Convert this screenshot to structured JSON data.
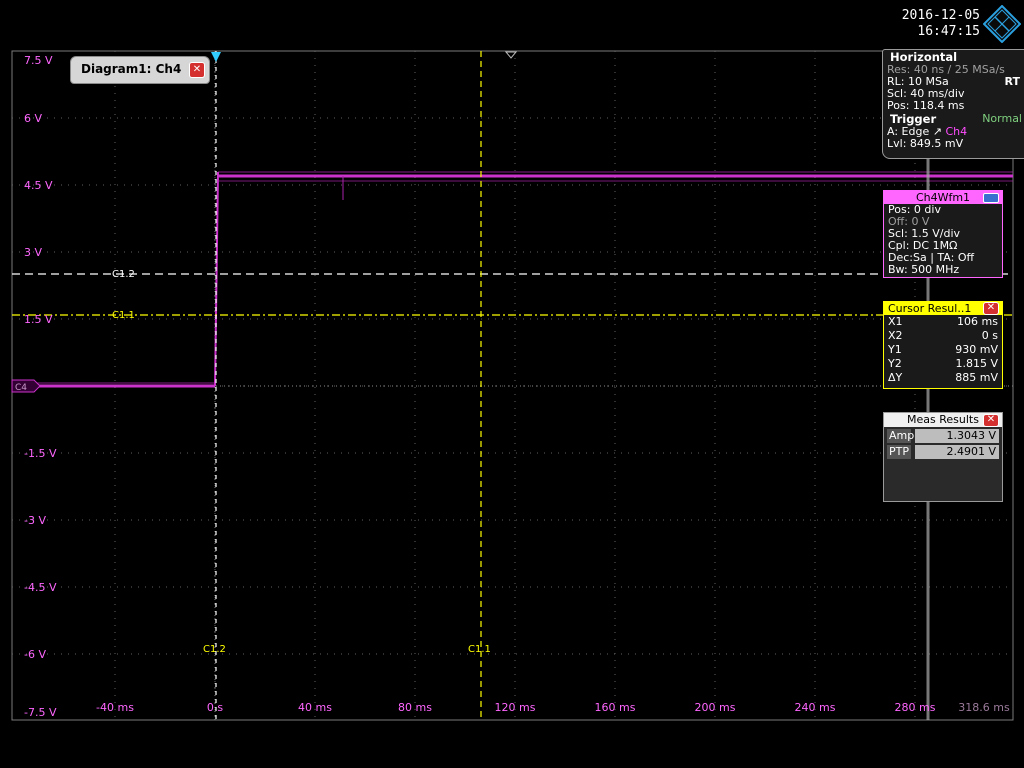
{
  "datetime": {
    "date": "2016-12-05",
    "time": "16:47:15"
  },
  "diagram": {
    "title": "Diagram1: Ch4"
  },
  "y_axis": {
    "labels": [
      "7.5 V",
      "6 V",
      "4.5 V",
      "3 V",
      "1.5 V",
      "-1.5 V",
      "-3 V",
      "-4.5 V",
      "-6 V",
      "-7.5 V"
    ]
  },
  "x_axis": {
    "labels": [
      "-40 ms",
      "0 s",
      "40 ms",
      "80 ms",
      "120 ms",
      "160 ms",
      "200 ms",
      "240 ms",
      "280 ms",
      "318.6 ms"
    ]
  },
  "channel_marker": "C4",
  "cursor_labels": {
    "c12": "C1.2",
    "c11": "C1.1"
  },
  "horizontal": {
    "title": "Horizontal",
    "res": "Res: 40 ns / 25 MSa/s",
    "rl": "RL:  10 MSa",
    "rt": "RT",
    "scl": "Scl:  40 ms/div",
    "pos": "Pos: 118.4 ms"
  },
  "trigger": {
    "title": "Trigger",
    "mode": "Normal",
    "source_prefix": "A:   Edge",
    "source": "Ch4",
    "level": "Lvl:  849.5 mV"
  },
  "waveform": {
    "title": "Ch4Wfm1",
    "lines": [
      "Pos: 0 div",
      "Off:  0 V",
      "Scl:  1.5 V/div",
      "Cpl:  DC 1MΩ",
      "Dec:Sa | TA: Off",
      "Bw:  500 MHz"
    ]
  },
  "cursor_results": {
    "title": "Cursor Resul..1",
    "rows": [
      {
        "name": "X1",
        "value": "106 ms"
      },
      {
        "name": "X2",
        "value": "0 s"
      },
      {
        "name": "Y1",
        "value": "930 mV"
      },
      {
        "name": "Y2",
        "value": "1.815 V"
      },
      {
        "name": "ΔY",
        "value": "885 mV"
      }
    ]
  },
  "meas_results": {
    "title": "Meas Results",
    "rows": [
      {
        "name": "Amp",
        "value": "1.3043 V"
      },
      {
        "name": "PTP",
        "value": "2.4901 V"
      }
    ]
  },
  "colors": {
    "trace": "#cc33cc",
    "cursor1": "#ffff00",
    "cursor2": "#ffffff",
    "grid": "#606060"
  }
}
